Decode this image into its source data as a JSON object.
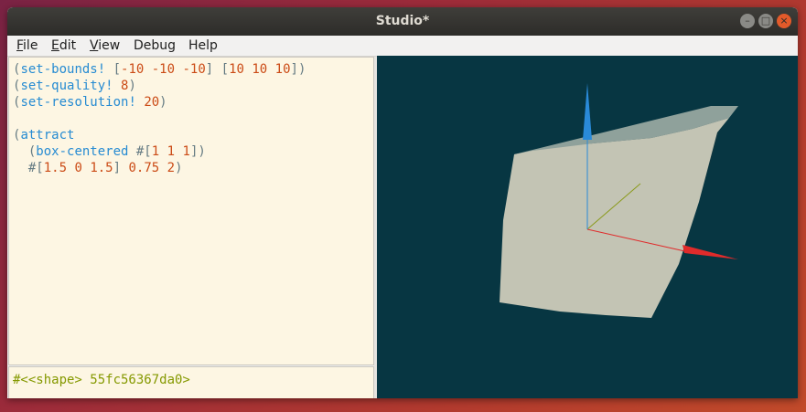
{
  "window": {
    "title": "Studio*"
  },
  "window_buttons": {
    "minimize": "–",
    "maximize": "□",
    "close": "×"
  },
  "menu": {
    "items": [
      {
        "mnemonic": "F",
        "rest": "ile"
      },
      {
        "mnemonic": "E",
        "rest": "dit"
      },
      {
        "mnemonic": "V",
        "rest": "iew"
      },
      {
        "mnemonic": "",
        "rest": "Debug"
      },
      {
        "mnemonic": "",
        "rest": "Help"
      }
    ]
  },
  "editor": {
    "lines": [
      [
        [
          "p",
          "("
        ],
        [
          "f",
          "set-bounds!"
        ],
        [
          "p",
          " ["
        ],
        [
          "n",
          "-10"
        ],
        [
          "p",
          " "
        ],
        [
          "n",
          "-10"
        ],
        [
          "p",
          " "
        ],
        [
          "n",
          "-10"
        ],
        [
          "p",
          "] ["
        ],
        [
          "n",
          "10"
        ],
        [
          "p",
          " "
        ],
        [
          "n",
          "10"
        ],
        [
          "p",
          " "
        ],
        [
          "n",
          "10"
        ],
        [
          "p",
          "])"
        ]
      ],
      [
        [
          "p",
          "("
        ],
        [
          "f",
          "set-quality!"
        ],
        [
          "p",
          " "
        ],
        [
          "n",
          "8"
        ],
        [
          "p",
          ")"
        ]
      ],
      [
        [
          "p",
          "("
        ],
        [
          "f",
          "set-resolution!"
        ],
        [
          "p",
          " "
        ],
        [
          "n",
          "20"
        ],
        [
          "p",
          ")"
        ]
      ],
      [],
      [
        [
          "p",
          "("
        ],
        [
          "f",
          "attract"
        ]
      ],
      [
        [
          "p",
          "  ("
        ],
        [
          "f",
          "box-centered"
        ],
        [
          "p",
          " #["
        ],
        [
          "n",
          "1"
        ],
        [
          "p",
          " "
        ],
        [
          "n",
          "1"
        ],
        [
          "p",
          " "
        ],
        [
          "n",
          "1"
        ],
        [
          "p",
          "])"
        ]
      ],
      [
        [
          "p",
          "  #["
        ],
        [
          "n",
          "1.5"
        ],
        [
          "p",
          " "
        ],
        [
          "n",
          "0"
        ],
        [
          "p",
          " "
        ],
        [
          "n",
          "1.5"
        ],
        [
          "p",
          "] "
        ],
        [
          "n",
          "0.75"
        ],
        [
          "p",
          " "
        ],
        [
          "n",
          "2"
        ],
        [
          "p",
          ")"
        ]
      ]
    ]
  },
  "result": {
    "text": "#<<shape> 55fc56367da0>"
  },
  "viewport": {
    "background": "#073642",
    "shape_front_color": "#c3c4b4",
    "shape_top_color": "#8fa19b",
    "shape_side_color": "#0d3640",
    "axis_x_color": "#e02b2b",
    "axis_y_color": "#8a9a1a",
    "axis_z_color": "#2a8ad8"
  }
}
